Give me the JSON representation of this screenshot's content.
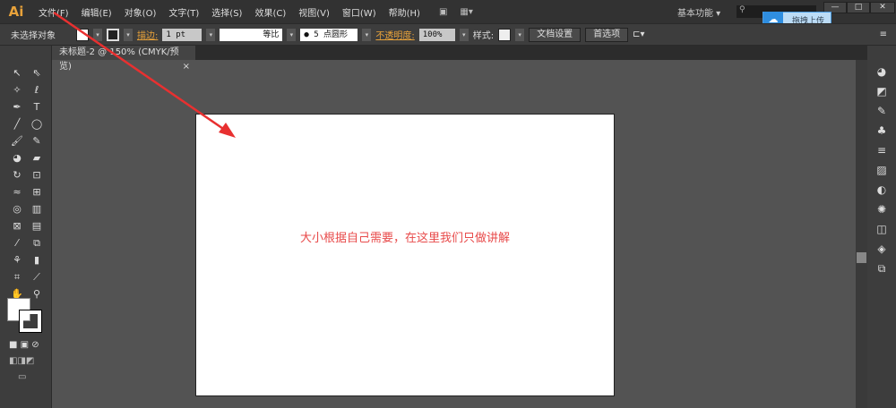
{
  "app": {
    "logo": "Ai"
  },
  "menu": [
    "文件(F)",
    "编辑(E)",
    "对象(O)",
    "文字(T)",
    "选择(S)",
    "效果(C)",
    "视图(V)",
    "窗口(W)",
    "帮助(H)"
  ],
  "workspace": "基本功能",
  "upload_label": "拖拽上传",
  "control": {
    "selection": "未选择对象",
    "stroke_label": "描边:",
    "stroke_weight": "1 pt",
    "stroke_profile": "等比",
    "brush": "5 点圆形",
    "opacity_label": "不透明度:",
    "opacity": "100%",
    "style_label": "样式:",
    "doc_setup": "文档设置",
    "preferences": "首选项"
  },
  "tab": {
    "title": "未标题-2 @ 150% (CMYK/预览)",
    "close": "×"
  },
  "artboard_text": "大小根据自己需要，在这里我们只做讲解",
  "colors": {
    "annotation": "#e84a4a",
    "accent": "#e8a23a"
  },
  "tools": [
    "selection",
    "direct-selection",
    "magic-wand",
    "lasso",
    "pen",
    "type",
    "line",
    "ellipse",
    "paintbrush",
    "pencil",
    "blob-brush",
    "eraser",
    "rotate",
    "scale",
    "warp",
    "free-transform",
    "shape-builder",
    "graph",
    "mesh",
    "gradient",
    "eyedropper",
    "blend",
    "symbol-sprayer",
    "column-graph",
    "artboard",
    "slice",
    "hand",
    "zoom"
  ],
  "right_panels": [
    "color",
    "color-guide",
    "brush",
    "symbol",
    "stroke",
    "gradient",
    "transparency",
    "appearance",
    "graphic-styles",
    "layers",
    "artboards"
  ]
}
